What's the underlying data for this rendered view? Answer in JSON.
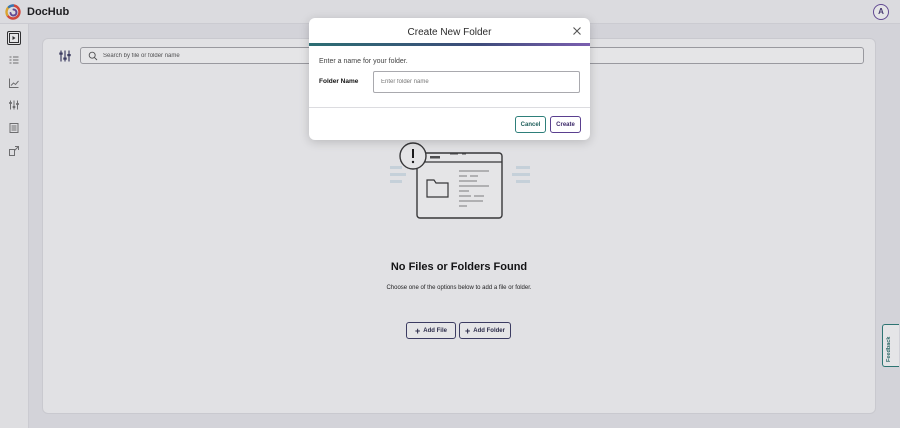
{
  "app": {
    "brand": "DocHub",
    "avatar_initial": "A"
  },
  "colors": {
    "accent_teal": "#2e7f7a",
    "accent_purple": "#5a3f8f",
    "navy": "#3f3f68"
  },
  "sidebar": {
    "items": [
      {
        "icon": "documents-icon",
        "active": true
      },
      {
        "icon": "checklist-icon",
        "active": false
      },
      {
        "icon": "analytics-icon",
        "active": false
      },
      {
        "icon": "filters-icon",
        "active": false
      },
      {
        "icon": "templates-icon",
        "active": false
      },
      {
        "icon": "integrations-icon",
        "active": false
      }
    ]
  },
  "search": {
    "placeholder": "Search by file or folder name",
    "value": ""
  },
  "empty_state": {
    "title": "No Files or Folders Found",
    "subtitle": "Choose one of the options below to add a file or folder.",
    "add_file_label": "Add File",
    "add_folder_label": "Add Folder"
  },
  "feedback_label": "Feedback",
  "modal": {
    "title": "Create New Folder",
    "prompt": "Enter a name for your folder.",
    "field_label": "Folder Name",
    "input_placeholder": "Enter folder name",
    "input_value": "",
    "cancel_label": "Cancel",
    "create_label": "Create"
  }
}
